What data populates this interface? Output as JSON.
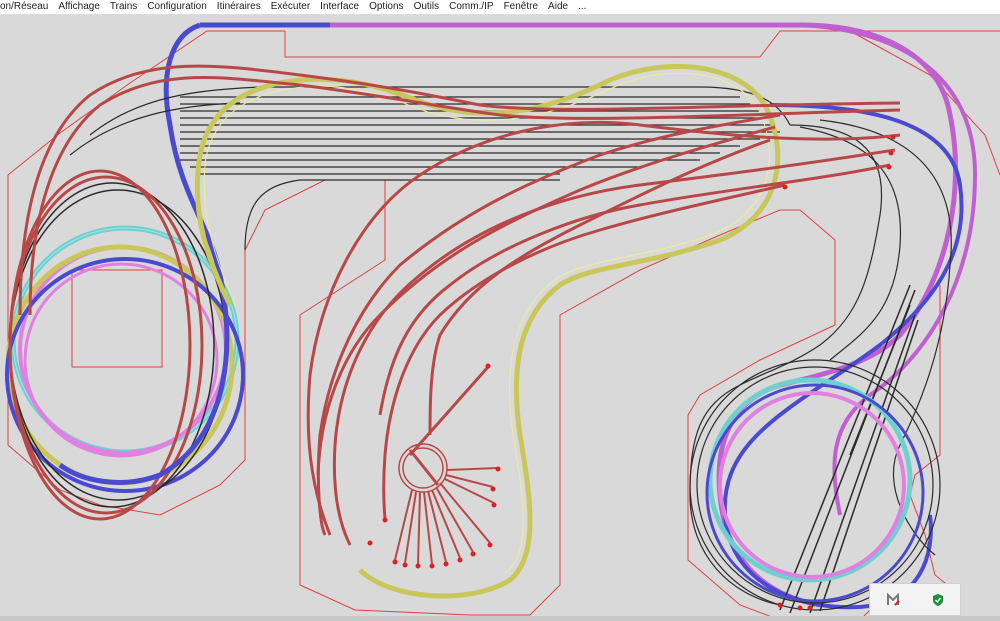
{
  "menu": {
    "items": [
      {
        "label": "on/Réseau"
      },
      {
        "label": "Affichage"
      },
      {
        "label": "Trains"
      },
      {
        "label": "Configuration"
      },
      {
        "label": "Itinéraires"
      },
      {
        "label": "Exécuter"
      },
      {
        "label": "Interface"
      },
      {
        "label": "Options"
      },
      {
        "label": "Outils"
      },
      {
        "label": "Comm./IP"
      },
      {
        "label": "Fenêtre"
      },
      {
        "label": "Aide"
      },
      {
        "label": "..."
      }
    ]
  },
  "colors": {
    "canvas_bg": "#d9d9d9",
    "board_outline": "#e04040",
    "track_black": "#2b2b2b",
    "track_red": "#b84848",
    "track_yellow": "#c9c75a",
    "track_blue": "#4a4ad0",
    "track_violet": "#c060d0",
    "track_cyan": "#70d0d0",
    "track_pink": "#e080e0"
  },
  "tray": {
    "icons": [
      {
        "icon": "monitor-m-icon"
      },
      {
        "icon": "shield-check-icon"
      }
    ]
  }
}
